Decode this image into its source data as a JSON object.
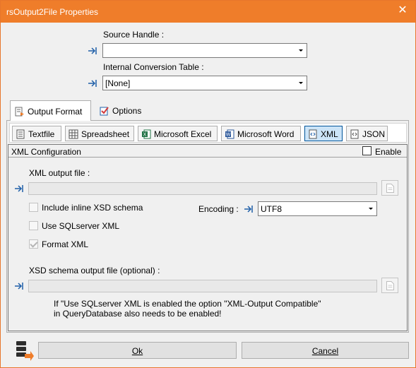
{
  "window": {
    "title": "rsOutput2File Properties",
    "close_glyph": "✕",
    "accent": "#ef7d2a"
  },
  "source_handle": {
    "label": "Source Handle :",
    "value": ""
  },
  "conversion_table": {
    "label": "Internal Conversion Table :",
    "value": "[None]"
  },
  "tabs": [
    {
      "label": "Output Format",
      "icon": "output-format-icon",
      "active": true
    },
    {
      "label": "Options",
      "icon": "options-icon",
      "active": false
    }
  ],
  "formats": [
    {
      "label": "Textfile",
      "icon": "textfile-icon",
      "selected": false
    },
    {
      "label": "Spreadsheet",
      "icon": "spreadsheet-icon",
      "selected": false
    },
    {
      "label": "Microsoft Excel",
      "icon": "excel-icon",
      "selected": false
    },
    {
      "label": "Microsoft Word",
      "icon": "word-icon",
      "selected": false
    },
    {
      "label": "XML",
      "icon": "xml-icon",
      "selected": true
    },
    {
      "label": "JSON",
      "icon": "json-icon",
      "selected": false
    }
  ],
  "xml_config": {
    "title": "XML Configuration",
    "enable_label": "Enable",
    "enable_checked": false,
    "output_file_label": "XML output file :",
    "output_file_value": "",
    "include_xsd_label": "Include inline XSD schema",
    "include_xsd_checked": false,
    "use_sqlserver_label": "Use SQLserver XML",
    "use_sqlserver_checked": false,
    "format_xml_label": "Format XML",
    "format_xml_checked": true,
    "encoding_label": "Encoding :",
    "encoding_value": "UTF8",
    "xsd_output_label": "XSD schema output file (optional) :",
    "xsd_output_value": "",
    "note_line1": "If \"Use SQLserver XML is enabled the option \"XML-Output Compatible\"",
    "note_line2": "in QueryDatabase also needs to be enabled!"
  },
  "footer": {
    "ok_label": "Ok",
    "cancel_label": "Cancel"
  }
}
